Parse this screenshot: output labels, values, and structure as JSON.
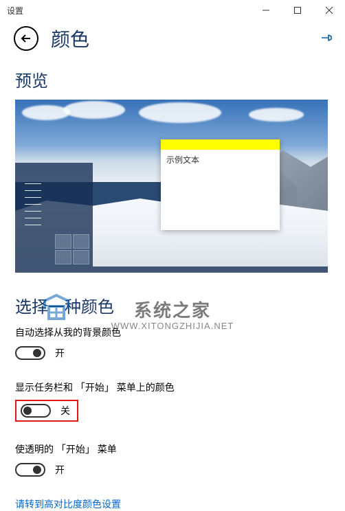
{
  "window": {
    "title": "设置"
  },
  "header": {
    "page_title": "颜色"
  },
  "sections": {
    "preview_heading": "预览",
    "choose_color_heading": "选择一种颜色"
  },
  "preview": {
    "example_text": "示例文本"
  },
  "watermark": {
    "title": "系统之家",
    "url": "WWW.XITONGZHIJIA.NET"
  },
  "settings": {
    "auto_pick": {
      "label": "自动选择从我的背景颜色",
      "state": "开",
      "on": true
    },
    "show_color": {
      "label": "显示任务栏和 「开始」 菜单上的颜色",
      "state": "关",
      "on": false
    },
    "transparent": {
      "label": "使透明的 「开始」 菜单",
      "state": "开",
      "on": true
    }
  },
  "link": {
    "high_contrast": "请转到高对比度颜色设置"
  }
}
